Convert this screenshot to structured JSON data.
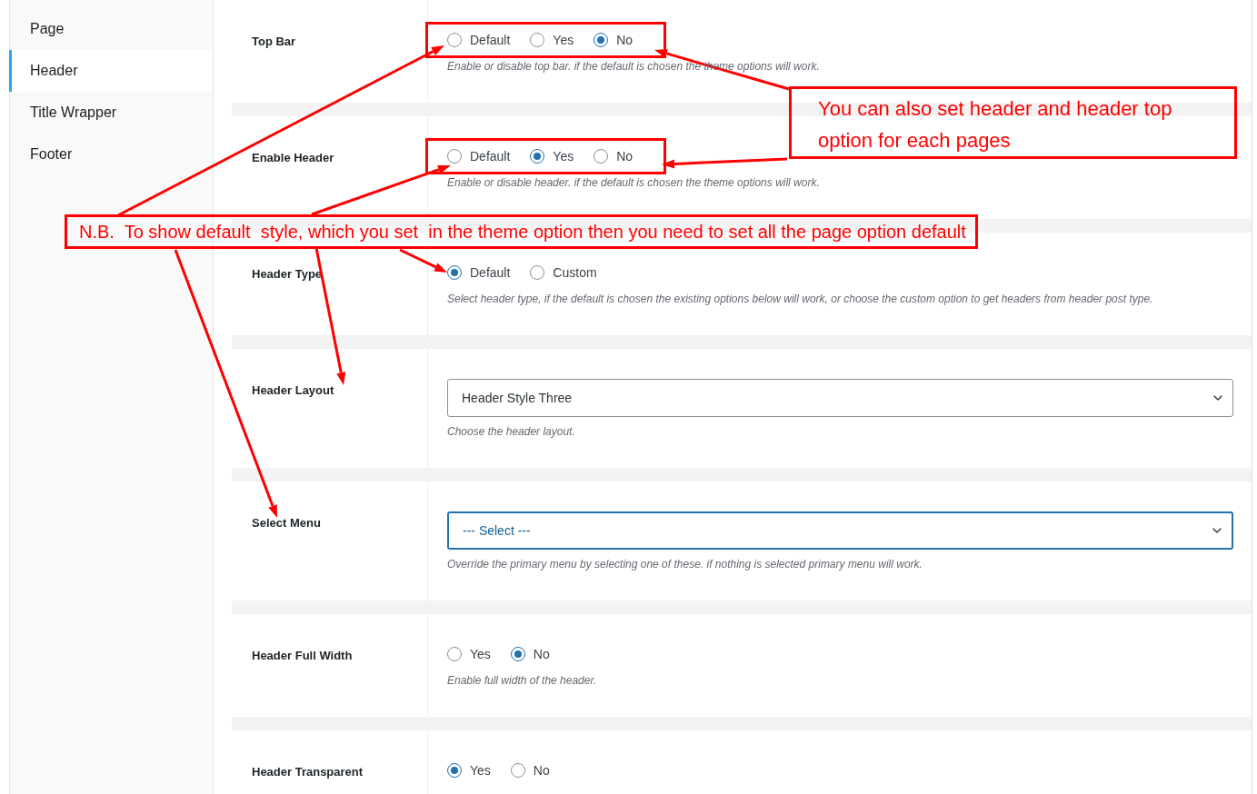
{
  "sidebar": {
    "items": [
      {
        "label": "Page",
        "selected": false
      },
      {
        "label": "Header",
        "selected": true
      },
      {
        "label": "Title Wrapper",
        "selected": false
      },
      {
        "label": "Footer",
        "selected": false
      }
    ]
  },
  "fields": [
    {
      "kind": "radio",
      "label": "Top Bar",
      "highlighted": true,
      "options": [
        {
          "label": "Default",
          "selected": false
        },
        {
          "label": "Yes",
          "selected": false
        },
        {
          "label": "No",
          "selected": true
        }
      ],
      "description": "Enable or disable top bar. if the default is chosen the theme options will work."
    },
    {
      "kind": "radio",
      "label": "Enable Header",
      "highlighted": true,
      "options": [
        {
          "label": "Default",
          "selected": false
        },
        {
          "label": "Yes",
          "selected": true
        },
        {
          "label": "No",
          "selected": false
        }
      ],
      "description": "Enable or disable header. if the default is chosen the theme options will work."
    },
    {
      "kind": "radio",
      "label": "Header Type",
      "highlighted": false,
      "options": [
        {
          "label": "Default",
          "selected": true
        },
        {
          "label": "Custom",
          "selected": false
        }
      ],
      "description": "Select header type, if the default is chosen the existing options below will work, or choose the custom option to get headers from header post type."
    },
    {
      "kind": "select",
      "label": "Header Layout",
      "value": "Header Style Three",
      "focused": false,
      "description": "Choose the header layout."
    },
    {
      "kind": "select",
      "label": "Select Menu",
      "value": "--- Select ---",
      "focused": true,
      "description": "Override the primary menu by selecting one of these. if nothing is selected primary menu will work."
    },
    {
      "kind": "radio",
      "label": "Header Full Width",
      "highlighted": false,
      "options": [
        {
          "label": "Yes",
          "selected": false
        },
        {
          "label": "No",
          "selected": true
        }
      ],
      "description": "Enable full width of the header."
    },
    {
      "kind": "radio",
      "label": "Header Transparent",
      "highlighted": false,
      "options": [
        {
          "label": "Yes",
          "selected": true
        },
        {
          "label": "No",
          "selected": false
        }
      ]
    }
  ],
  "notes": [
    "You can also set header and header top option for each pages",
    "N.B.  To show default  style, which you set  in the theme option then you need to set all the page option default"
  ]
}
